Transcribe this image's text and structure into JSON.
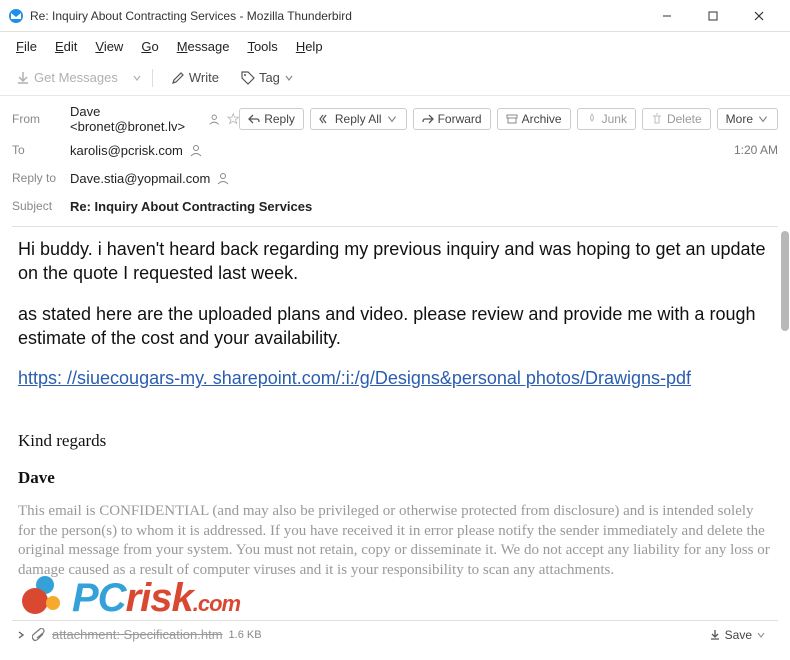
{
  "window": {
    "title": "Re: Inquiry About Contracting Services - Mozilla Thunderbird"
  },
  "menubar": {
    "items": [
      "File",
      "Edit",
      "View",
      "Go",
      "Message",
      "Tools",
      "Help"
    ]
  },
  "toolbar": {
    "get_messages": "Get Messages",
    "write": "Write",
    "tag": "Tag"
  },
  "actions": {
    "reply": "Reply",
    "reply_all": "Reply All",
    "forward": "Forward",
    "archive": "Archive",
    "junk": "Junk",
    "delete": "Delete",
    "more": "More"
  },
  "headers": {
    "from_label": "From",
    "from_value": "Dave <bronet@bronet.lv>",
    "to_label": "To",
    "to_value": "karolis@pcrisk.com",
    "reply_to_label": "Reply to",
    "reply_to_value": "Dave.stia@yopmail.com",
    "subject_label": "Subject",
    "subject_value": "Re: Inquiry About Contracting Services",
    "time": "1:20 AM"
  },
  "body": {
    "p1": "Hi buddy. i haven't heard back regarding my previous inquiry and was hoping to get an update on the quote I requested last week.",
    "p2": "as stated here are the uploaded plans and video. please review and provide me with a rough estimate of the cost and your availability.",
    "link": "https:   //siuecougars-my. sharepoint.com/:i:/g/Designs&personal photos/Drawigns-pdf",
    "signoff": "Kind regards",
    "signature": "Dave",
    "disclaimer": "This email is CONFIDENTIAL (and may also be privileged or otherwise protected from disclosure) and is intended solely for the person(s) to whom it is addressed. If you have received it in error please notify the sender immediately and delete the original message from your system. You must not retain, copy or disseminate it. We do not accept any liability for any loss or damage caused as a result of computer viruses and it is your responsibility to scan any attachments."
  },
  "attachment": {
    "name": "attachment: Specification.htm",
    "size": "1.6 KB",
    "save": "Save"
  },
  "watermark": {
    "pc": "PC",
    "risk": "risk",
    "com": ".com"
  }
}
